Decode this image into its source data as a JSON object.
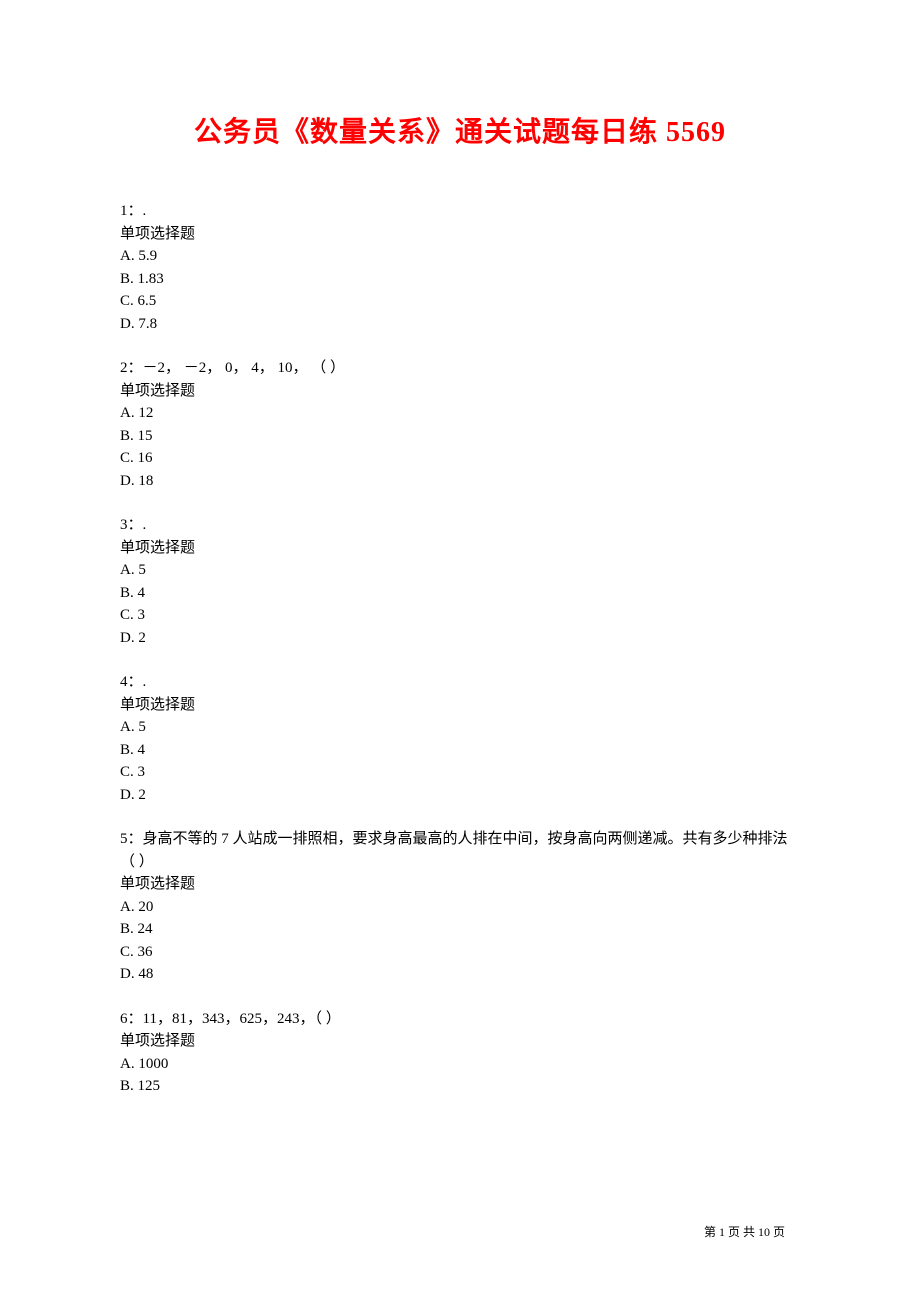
{
  "title": "公务员《数量关系》通关试题每日练 5569",
  "questions": [
    {
      "number": "1：.",
      "type": "单项选择题",
      "options": [
        "A. 5.9",
        "B. 1.83",
        "C. 6.5",
        "D. 7.8"
      ]
    },
    {
      "number": "2：－2， －2， 0， 4， 10， （ ）",
      "type": "单项选择题",
      "options": [
        "A. 12",
        "B. 15",
        "C. 16",
        "D. 18"
      ]
    },
    {
      "number": "3：.",
      "type": "单项选择题",
      "options": [
        "A. 5",
        "B. 4",
        "C. 3",
        "D. 2"
      ]
    },
    {
      "number": "4：.",
      "type": "单项选择题",
      "options": [
        "A. 5",
        "B. 4",
        "C. 3",
        "D. 2"
      ]
    },
    {
      "number": "5：身高不等的 7 人站成一排照相，要求身高最高的人排在中间，按身高向两侧递减。共有多少种排法（ ）",
      "type": "单项选择题",
      "options": [
        "A. 20",
        "B. 24",
        "C. 36",
        "D. 48"
      ]
    },
    {
      "number": "6：11，81，343，625，243，（  ）",
      "type": "单项选择题",
      "options": [
        "A. 1000",
        "B. 125"
      ]
    }
  ],
  "footer": {
    "prefix": "第 ",
    "current": "1",
    "middle": " 页 共 ",
    "total": "10",
    "suffix": " 页"
  }
}
